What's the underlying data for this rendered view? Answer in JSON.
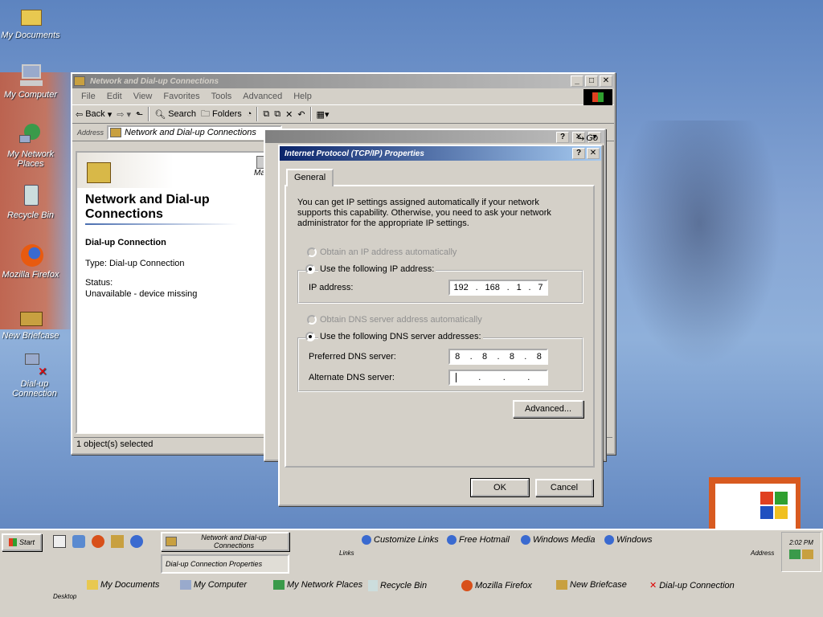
{
  "desktop": {
    "icons": [
      {
        "label": "My Documents"
      },
      {
        "label": "My Computer"
      },
      {
        "label": "My Network Places"
      },
      {
        "label": "Recycle Bin"
      },
      {
        "label": "Mozilla Firefox"
      },
      {
        "label": "New Briefcase"
      },
      {
        "label": "Dial-up Connection"
      }
    ]
  },
  "explorer": {
    "title": "Network and Dial-up Connections",
    "menu": [
      "File",
      "Edit",
      "View",
      "Favorites",
      "Tools",
      "Advanced",
      "Help"
    ],
    "toolbar": {
      "back": "Back",
      "search": "Search",
      "folders": "Folders"
    },
    "address_label": "Address",
    "address_value": "Network and Dial-up Connections",
    "go": "Go",
    "panel_title": "Network and Dial-up Connections",
    "selected_name": "Dial-up Connection",
    "type_line": "Type: Dial-up Connection",
    "status_label": "Status:",
    "status_value": "Unavailable - device missing",
    "item_label": "Make New Conn",
    "status_bar": "1 object(s) selected"
  },
  "dialog": {
    "title": "Internet Protocol (TCP/IP) Properties",
    "tab": "General",
    "intro": "You can get IP settings assigned automatically if your network supports this capability. Otherwise, you need to ask your network administrator for the appropriate IP settings.",
    "obtain_ip": "Obtain an IP address automatically",
    "use_ip": "Use the following IP address:",
    "ip_label": "IP address:",
    "ip": [
      "192",
      "168",
      "1",
      "7"
    ],
    "obtain_dns": "Obtain DNS server address automatically",
    "use_dns": "Use the following DNS server addresses:",
    "preferred_label": "Preferred DNS server:",
    "preferred": [
      "8",
      "8",
      "8",
      "8"
    ],
    "alternate_label": "Alternate DNS server:",
    "alternate": [
      "",
      "",
      "",
      ""
    ],
    "advanced": "Advanced...",
    "ok": "OK",
    "cancel": "Cancel"
  },
  "taskbar": {
    "start": "Start",
    "tasks": [
      "Network and Dial-up Connections",
      "Dial-up Connection Properties"
    ],
    "links_label": "Links",
    "links": [
      "Customize Links",
      "Free Hotmail",
      "Windows Media",
      "Windows"
    ],
    "address_label": "Address",
    "clock": "2:02 PM",
    "desktop_label": "Desktop",
    "desktop_items": [
      "My Documents",
      "My Computer",
      "My Network Places",
      "Recycle Bin",
      "Mozilla Firefox",
      "New Briefcase",
      "Dial-up Connection"
    ]
  }
}
